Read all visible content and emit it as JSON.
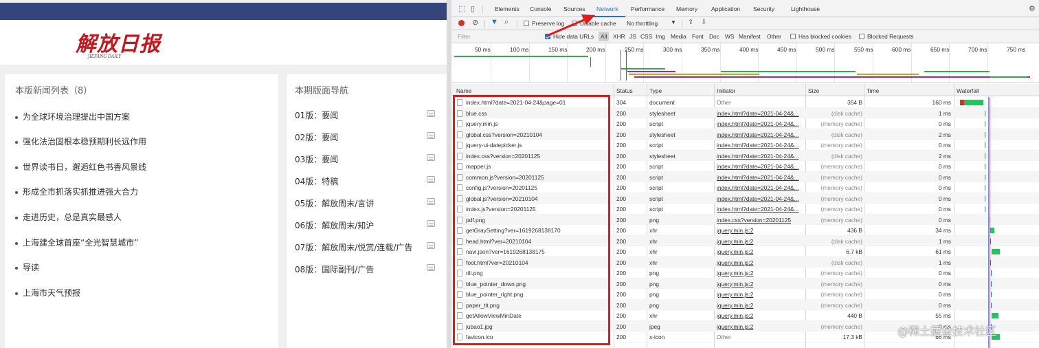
{
  "site": {
    "logo_text": "解放日报",
    "logo_sub": "JIEFANG DAILY",
    "news_panel": {
      "title": "本版新闻列表（8）",
      "items": [
        "为全球环境治理提出中国方案",
        "强化法治固根本稳预期利长远作用",
        "世界读书日，邂逅红色书香风景线",
        "形成全市抓落实抓推进强大合力",
        "走进历史，总是真实最感人",
        "上海建全球首座“全光智慧城市”",
        "导读",
        "上海市天气预报"
      ]
    },
    "nav_panel": {
      "title": "本期版面导航",
      "items": [
        "01版：要闻",
        "02版：要闻",
        "03版：要闻",
        "04版：特稿",
        "05版：解放周末/言讲",
        "06版：解放周末/知沪",
        "07版：解放周末/悦赏/连载/广告",
        "08版：国际副刊/广告"
      ]
    }
  },
  "devtools": {
    "tabs": [
      "Elements",
      "Console",
      "Sources",
      "Network",
      "Performance",
      "Memory",
      "Application",
      "Security",
      "Lighthouse"
    ],
    "active_tab": "Network",
    "toolbar": {
      "preserve_log": "Preserve log",
      "disable_cache": "Disable cache",
      "throttling": "No throttling"
    },
    "filter": {
      "placeholder": "Filter",
      "hide_data_urls": "Hide data URLs",
      "types": [
        "All",
        "XHR",
        "JS",
        "CSS",
        "Img",
        "Media",
        "Font",
        "Doc",
        "WS",
        "Manifest",
        "Other"
      ],
      "has_blocked_cookies": "Has blocked cookies",
      "blocked_requests": "Blocked Requests"
    },
    "timeline_labels": [
      "50 ms",
      "100 ms",
      "150 ms",
      "200 ms",
      "250 ms",
      "300 ms",
      "350 ms",
      "400 ms",
      "450 ms",
      "500 ms",
      "550 ms",
      "600 ms",
      "650 ms",
      "700 ms",
      "750 ms"
    ],
    "columns": [
      "Name",
      "Status",
      "Type",
      "Initiator",
      "Size",
      "Time",
      "Waterfall"
    ],
    "rows": [
      {
        "name": "index.html?date=2021-04-24&page=01",
        "status": "304",
        "type": "document",
        "initiator": "Other",
        "size": "354 B",
        "time": "160 ms"
      },
      {
        "name": "blue.css",
        "status": "200",
        "type": "stylesheet",
        "initiator": "index.html?date=2021-04-24&...",
        "size": "(disk cache)",
        "time": "1 ms"
      },
      {
        "name": "jquery.min.js",
        "status": "200",
        "type": "script",
        "initiator": "index.html?date=2021-04-24&...",
        "size": "(memory cache)",
        "time": "0 ms"
      },
      {
        "name": "global.css?version=20210104",
        "status": "200",
        "type": "stylesheet",
        "initiator": "index.html?date=2021-04-24&...",
        "size": "(disk cache)",
        "time": "2 ms"
      },
      {
        "name": "jquery-ui-datepicker.js",
        "status": "200",
        "type": "script",
        "initiator": "index.html?date=2021-04-24&...",
        "size": "(memory cache)",
        "time": "0 ms"
      },
      {
        "name": "index.css?version=20201125",
        "status": "200",
        "type": "stylesheet",
        "initiator": "index.html?date=2021-04-24&...",
        "size": "(disk cache)",
        "time": "2 ms"
      },
      {
        "name": "mapper.js",
        "status": "200",
        "type": "script",
        "initiator": "index.html?date=2021-04-24&...",
        "size": "(memory cache)",
        "time": "0 ms"
      },
      {
        "name": "common.js?version=20201125",
        "status": "200",
        "type": "script",
        "initiator": "index.html?date=2021-04-24&...",
        "size": "(memory cache)",
        "time": "0 ms"
      },
      {
        "name": "config.js?version=20201125",
        "status": "200",
        "type": "script",
        "initiator": "index.html?date=2021-04-24&...",
        "size": "(memory cache)",
        "time": "0 ms"
      },
      {
        "name": "global.js?version=20210104",
        "status": "200",
        "type": "script",
        "initiator": "index.html?date=2021-04-24&...",
        "size": "(memory cache)",
        "time": "0 ms"
      },
      {
        "name": "index.js?version=20201125",
        "status": "200",
        "type": "script",
        "initiator": "index.html?date=2021-04-24&...",
        "size": "(memory cache)",
        "time": "0 ms"
      },
      {
        "name": "pdf.png",
        "status": "200",
        "type": "png",
        "initiator": "index.css?version=20201125",
        "size": "(memory cache)",
        "time": "0 ms"
      },
      {
        "name": "getGraySetting?ver=1619268138170",
        "status": "200",
        "type": "xhr",
        "initiator": "jquery.min.js:2",
        "size": "436 B",
        "time": "34 ms"
      },
      {
        "name": "head.html?ver=20210104",
        "status": "200",
        "type": "xhr",
        "initiator": "jquery.min.js:2",
        "size": "(disk cache)",
        "time": "1 ms"
      },
      {
        "name": "navi.json?ver=1619268138175",
        "status": "200",
        "type": "xhr",
        "initiator": "jquery.min.js:2",
        "size": "6.7 kB",
        "time": "61 ms"
      },
      {
        "name": "foot.html?ver=20210104",
        "status": "200",
        "type": "xhr",
        "initiator": "jquery.min.js:2",
        "size": "(disk cache)",
        "time": "1 ms"
      },
      {
        "name": "rili.png",
        "status": "200",
        "type": "png",
        "initiator": "jquery.min.js:2",
        "size": "(memory cache)",
        "time": "0 ms"
      },
      {
        "name": "blue_pointer_down.png",
        "status": "200",
        "type": "png",
        "initiator": "jquery.min.js:2",
        "size": "(memory cache)",
        "time": "0 ms"
      },
      {
        "name": "blue_pointer_right.png",
        "status": "200",
        "type": "png",
        "initiator": "jquery.min.js:2",
        "size": "(memory cache)",
        "time": "0 ms"
      },
      {
        "name": "paper_tit.png",
        "status": "200",
        "type": "png",
        "initiator": "jquery.min.js:2",
        "size": "(memory cache)",
        "time": "0 ms"
      },
      {
        "name": "getAllowViewMinDate",
        "status": "200",
        "type": "xhr",
        "initiator": "jquery.min.js:2",
        "size": "440 B",
        "time": "55 ms"
      },
      {
        "name": "jubao1.jpg",
        "status": "200",
        "type": "jpeg",
        "initiator": "jquery.min.js:2",
        "size": "(memory cache)",
        "time": "0 ms"
      },
      {
        "name": "favicon.ico",
        "status": "200",
        "type": "x-icon",
        "initiator": "Other",
        "size": "17.3 kB",
        "time": "66 ms"
      }
    ],
    "watermark": "@稀土掘金技术社区"
  }
}
